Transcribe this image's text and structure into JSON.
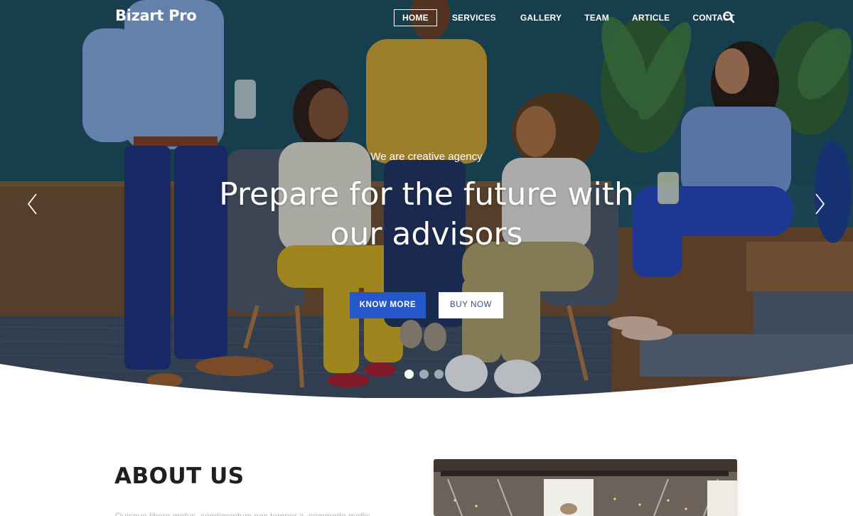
{
  "brand": "Bizart Pro",
  "nav": {
    "items": [
      "HOME",
      "SERVICES",
      "GALLERY",
      "TEAM",
      "ARTICLE",
      "CONTACT"
    ],
    "active": "HOME"
  },
  "hero": {
    "subtitle": "We are creative agency",
    "title_line1": "Prepare for the future with",
    "title_line2": "our advisors",
    "primary_button": "KNOW MORE",
    "secondary_button": "BUY NOW",
    "slide_count": 3,
    "active_slide": 1
  },
  "about": {
    "title": "ABOUT US",
    "text": "Quisque libero metus, condimentum nec tempor a, commodo mollis"
  },
  "colors": {
    "accent": "#2457c9",
    "wall": "#1e4d5c",
    "text_dark": "#1f1f1f"
  },
  "icons": {
    "search": "search-icon",
    "prev": "chevron-left-icon",
    "next": "chevron-right-icon"
  }
}
